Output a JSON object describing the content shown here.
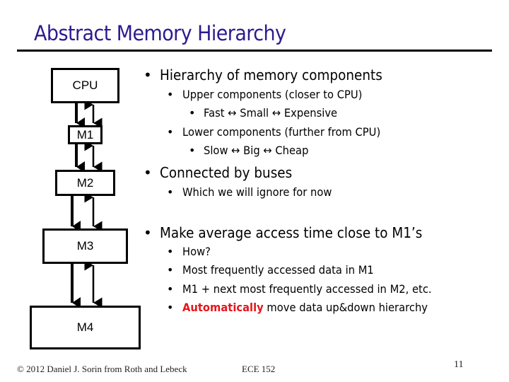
{
  "slide": {
    "title": "Abstract Memory Hierarchy",
    "diagram": {
      "boxes": [
        "CPU",
        "M1",
        "M2",
        "M3",
        "M4"
      ]
    },
    "bullets": {
      "b1": {
        "text": "Hierarchy of memory components",
        "sub1": "Upper components (closer to CPU)",
        "sub1a": "Fast ↔ Small ↔ Expensive",
        "sub2": "Lower components (further from CPU)",
        "sub2a": "Slow ↔ Big ↔ Cheap"
      },
      "b2": {
        "text": "Connected by buses",
        "sub1": "Which we will ignore for now"
      },
      "b3": {
        "text": "Make average access time close to M1’s",
        "sub1": "How?",
        "sub2": "Most frequently accessed data in M1",
        "sub3": "M1 + next most frequently accessed in M2, etc.",
        "sub4_highlight": "Automatically",
        "sub4_rest": " move data up&down hierarchy"
      }
    },
    "footer": {
      "copyright": "© 2012 Daniel J. Sorin from Roth and Lebeck",
      "course": "ECE 152",
      "page": "11"
    },
    "colors": {
      "title": "#2e1a8e",
      "highlight": "#e8141b"
    }
  }
}
